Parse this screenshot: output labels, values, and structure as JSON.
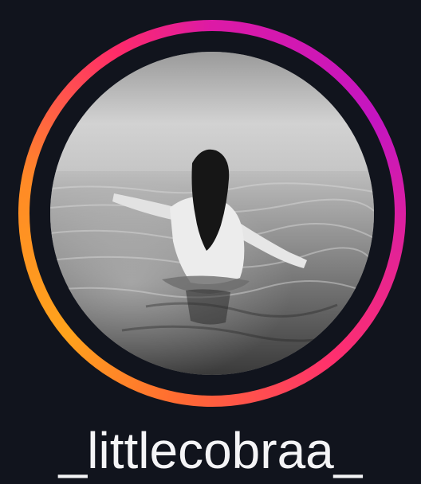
{
  "profile": {
    "username": "_littlecobraa_",
    "has_unseen_story": true
  },
  "avatar": {
    "icon": "profile-photo",
    "style": "grayscale"
  },
  "colors": {
    "background": "#11141d",
    "ring_gradient": [
      "#c415c1",
      "#dc1aa6",
      "#ff2f6e",
      "#ff6a32",
      "#ffa31c"
    ],
    "username_text": "#f4f4f6"
  }
}
